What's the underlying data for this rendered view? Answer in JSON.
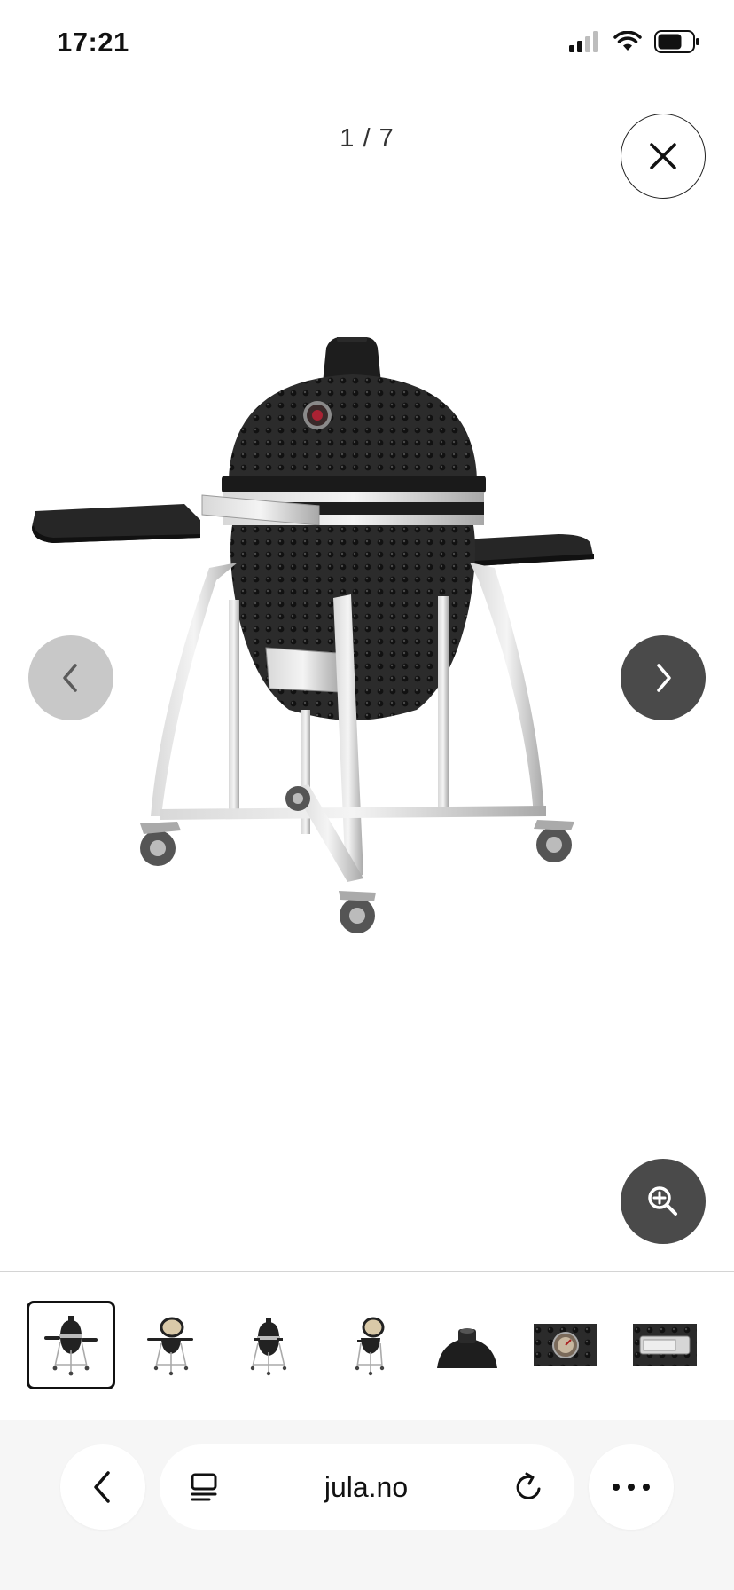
{
  "status_bar": {
    "time": "17:21"
  },
  "gallery": {
    "counter": "1 / 7",
    "current_index": 1,
    "total": 7,
    "close_icon": "close-icon",
    "prev_icon": "chevron-left-icon",
    "next_icon": "chevron-right-icon",
    "zoom_icon": "zoom-in-icon",
    "thumbnails": [
      {
        "icon": "grill-front-thumbnail",
        "active": true
      },
      {
        "icon": "grill-open-lid-thumbnail",
        "active": false
      },
      {
        "icon": "grill-closed-thumbnail",
        "active": false
      },
      {
        "icon": "grill-open-side-thumbnail",
        "active": false
      },
      {
        "icon": "grill-top-vent-thumbnail",
        "active": false
      },
      {
        "icon": "grill-thermometer-thumbnail",
        "active": false
      },
      {
        "icon": "grill-ash-door-thumbnail",
        "active": false
      }
    ]
  },
  "browser": {
    "url": "jula.no",
    "back_icon": "chevron-left-icon",
    "tabs_icon": "page-menu-icon",
    "reload_icon": "reload-icon",
    "more_icon": "more-icon"
  }
}
